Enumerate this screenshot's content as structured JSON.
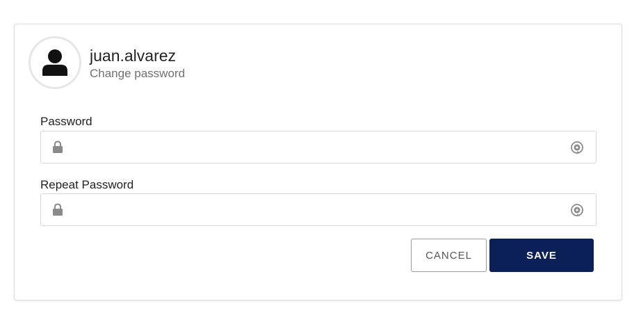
{
  "user": {
    "username": "juan.alvarez",
    "subtitle": "Change password"
  },
  "form": {
    "password": {
      "label": "Password",
      "value": "",
      "placeholder": ""
    },
    "repeat_password": {
      "label": "Repeat Password",
      "value": "",
      "placeholder": ""
    }
  },
  "actions": {
    "cancel_label": "CANCEL",
    "save_label": "SAVE"
  },
  "icons": {
    "avatar": "user-icon",
    "field_left": "lock-icon",
    "field_right": "eye-reveal-icon"
  },
  "colors": {
    "primary": "#0b2057",
    "border": "#d6d6d6",
    "icon": "#8a8a8a"
  }
}
